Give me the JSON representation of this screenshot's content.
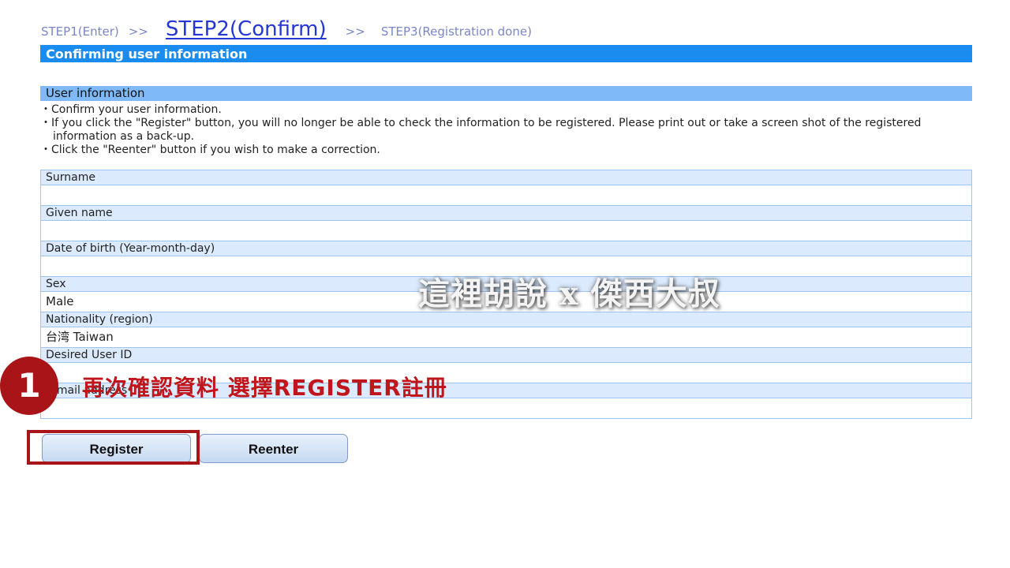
{
  "steps": {
    "step1": "STEP1(Enter)",
    "sep1": ">>",
    "step2": "STEP2(Confirm)",
    "sep2": ">>",
    "step3": "STEP3(Registration done)"
  },
  "header": {
    "title": "Confirming user information"
  },
  "section": {
    "title": "User information",
    "notes": [
      "・Confirm your user information.",
      "・If you click the \"Register\" button, you will no longer be able to check the information to be registered. Please print out or take a screen shot of the registered",
      "information as a back-up.",
      "・Click the \"Reenter\" button if you wish to make a correction."
    ]
  },
  "fields": [
    {
      "label": "Surname",
      "value": ""
    },
    {
      "label": "Given name",
      "value": ""
    },
    {
      "label": "Date of birth (Year-month-day)",
      "value": ""
    },
    {
      "label": "Sex",
      "value": "Male"
    },
    {
      "label": "Nationality (region)",
      "value": "台湾 Taiwan"
    },
    {
      "label": "Desired User ID",
      "value": ""
    },
    {
      "label": "E-mail address",
      "value": ""
    }
  ],
  "buttons": {
    "register": "Register",
    "reenter": "Reenter"
  },
  "overlay": {
    "watermark": "這裡胡說 x 傑西大叔",
    "badge_number": "1",
    "caption": "再次確認資料  選擇REGISTER註冊"
  },
  "colors": {
    "primary_bar": "#1a8cf0",
    "section_bar": "#80b9f7",
    "accent_red": "#a81418"
  }
}
